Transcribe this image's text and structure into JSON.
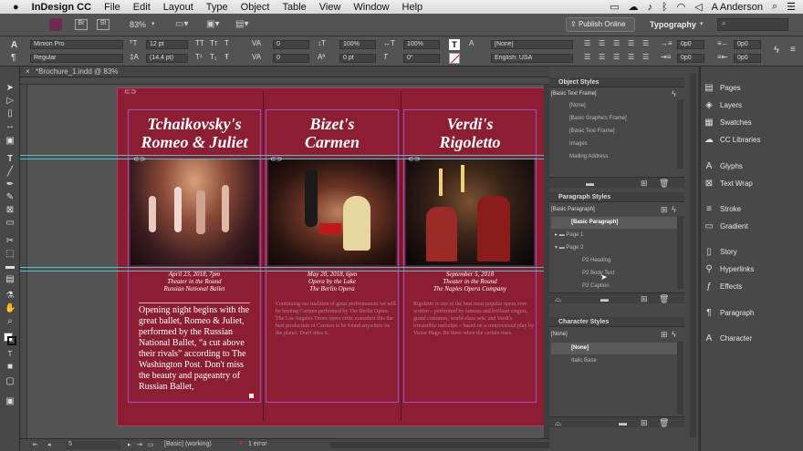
{
  "menubar": {
    "apple": "",
    "app": "InDesign CC",
    "items": [
      "File",
      "Edit",
      "Layout",
      "Type",
      "Object",
      "Table",
      "View",
      "Window",
      "Help"
    ],
    "user": "A Anderson"
  },
  "appbar": {
    "br": "Br",
    "st": "St",
    "zoom": "83%",
    "publish": "Publish Online",
    "workspace": "Typography",
    "search_placeholder": ""
  },
  "control": {
    "font": "Minion Pro",
    "style": "Regular",
    "size": "12 pt",
    "leading": "(14.4 pt)",
    "tracking_val": "0",
    "kerning_val": "0",
    "scale_v": "100%",
    "scale_h": "100%",
    "baseline": "0 pt",
    "skew": "0°",
    "para_style": "[None]",
    "lang": "English: USA",
    "indent1": "0p0",
    "indent2": "0p0",
    "indent3": "0p0",
    "indent4": "0p0"
  },
  "doctab": {
    "title": "*Brochure_1.indd @ 83%"
  },
  "brochure": {
    "panels": [
      {
        "title1": "Tchaikovsky's",
        "title2": "Romeo & Juliet",
        "cap1": "April 23, 2018, 7pm",
        "cap2": "Theater in the Round",
        "cap3": "Russian National Ballet",
        "body": "Opening night begins with the great ballet, Romeo & Juliet, performed by the Russian National Ballet, “a cut above their rivals” according to The Washington Post. Don't miss the beauty and pageantry of Russian Ballet,"
      },
      {
        "title1": "Bizet's",
        "title2": "Carmen",
        "cap1": "May 20, 2018, 6pm",
        "cap2": "Opera by the Lake",
        "cap3": "The Berlin Opera",
        "body": "Continuing our tradition of great performances we will be hosting Carmen performed by The Berlin Opera. The Los Angeles Times opera critic considers this the best production of Carmen to be found anywhere on the planet. Don't miss it."
      },
      {
        "title1": "Verdi's",
        "title2": "Rigoletto",
        "cap1": "September 5, 2018",
        "cap2": "Theater in the Round",
        "cap3": "The Naples Opera Company",
        "body": "Rigoletto is one of the best most popular opera ever written – performed by famous and brilliant singers, grand costumes, world-class sets, and Verdi's irresistible melodies – based on a controversial play by Victor Hugo. Be there when the curtain rises."
      }
    ]
  },
  "status": {
    "page": "5",
    "style": "[Basic] (working)",
    "errors": "1 error"
  },
  "object_styles": {
    "header": "Object Styles",
    "current": "[Basic Text Frame]",
    "rows": [
      "[None]",
      "[Basic Graphics Frame]",
      "[Basic Text Frame]",
      "Images",
      "Mailing Address"
    ]
  },
  "paragraph_styles": {
    "header": "Paragraph Styles",
    "current": "[Basic Paragraph]",
    "rows": [
      "[Basic Paragraph]",
      "Page 1",
      "Page 2",
      "P2 Heading",
      "P2 Body Text",
      "P2 Caption"
    ]
  },
  "character_styles": {
    "header": "Character Styles",
    "current": "[None]",
    "rows": [
      "[None]",
      "Italic Base"
    ]
  },
  "dock": [
    {
      "icon": "▤",
      "label": "Pages"
    },
    {
      "icon": "◈",
      "label": "Layers"
    },
    {
      "icon": "▦",
      "label": "Swatches"
    },
    {
      "icon": "☁",
      "label": "CC Libraries"
    },
    {
      "icon": "A",
      "label": "Glyphs"
    },
    {
      "icon": "⊠",
      "label": "Text Wrap"
    },
    {
      "icon": "≡",
      "label": "Stroke"
    },
    {
      "icon": "▭",
      "label": "Gradient"
    },
    {
      "icon": "▯",
      "label": "Story"
    },
    {
      "icon": "⚲",
      "label": "Hyperlinks"
    },
    {
      "icon": "ƒ",
      "label": "Effects"
    },
    {
      "icon": "¶",
      "label": "Paragraph"
    },
    {
      "icon": "A",
      "label": "Character"
    }
  ],
  "colors": {
    "page": "#8c1e34",
    "guide": "#4ec0c8",
    "frame": "#a050c0"
  }
}
